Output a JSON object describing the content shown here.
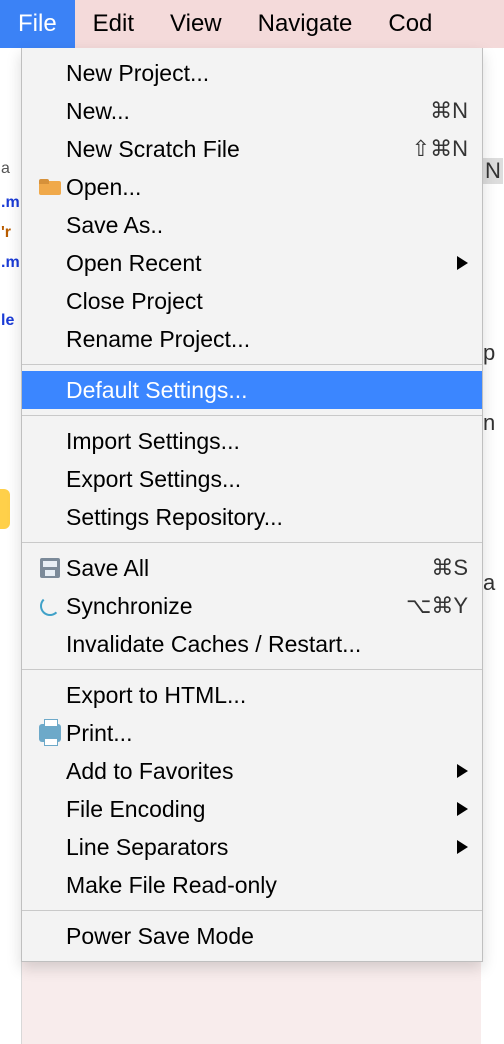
{
  "menubar": {
    "file": "File",
    "edit": "Edit",
    "view": "View",
    "navigate": "Navigate",
    "code": "Cod"
  },
  "menu": {
    "new_project": "New Project...",
    "new": "New...",
    "new_shortcut": "⌘N",
    "new_scratch": "New Scratch File",
    "new_scratch_shortcut": "⇧⌘N",
    "open": "Open...",
    "save_as": "Save As..",
    "open_recent": "Open Recent",
    "close_project": "Close Project",
    "rename_project": "Rename Project...",
    "default_settings": "Default Settings...",
    "import_settings": "Import Settings...",
    "export_settings": "Export Settings...",
    "settings_repository": "Settings Repository...",
    "save_all": "Save All",
    "save_all_shortcut": "⌘S",
    "synchronize": "Synchronize",
    "synchronize_shortcut": "⌥⌘Y",
    "invalidate_caches": "Invalidate Caches / Restart...",
    "export_to_html": "Export to HTML...",
    "print": "Print...",
    "add_to_favorites": "Add to Favorites",
    "file_encoding": "File Encoding",
    "line_separators": "Line Separators",
    "make_readonly": "Make File Read-only",
    "power_save": "Power Save Mode"
  },
  "left_strip": {
    "a": "a",
    "m1": ".m",
    "r": "'r",
    "m2": ".m",
    "le": "le"
  },
  "bg": {
    "N": "N",
    "p": "p",
    "n": "n",
    "a": "a"
  }
}
